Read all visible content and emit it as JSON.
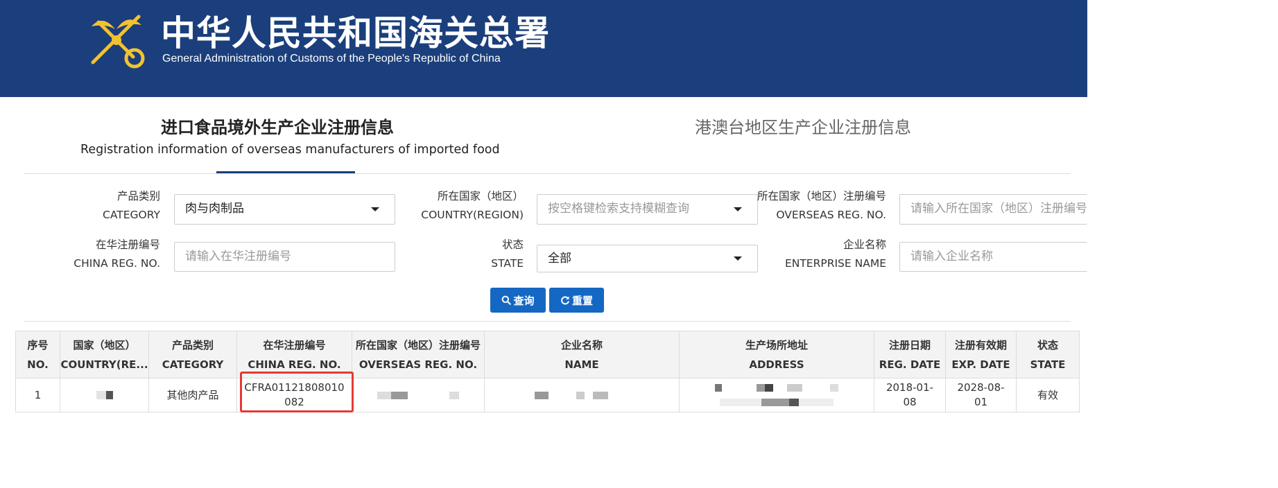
{
  "header": {
    "title_cn": "中华人民共和国海关总署",
    "title_en": "General Administration of Customs of the People's Republic of China"
  },
  "tabs": {
    "active_cn": "进口食品境外生产企业注册信息",
    "active_en": "Registration information of overseas manufacturers of imported food",
    "inactive_cn": "港澳台地区生产企业注册信息"
  },
  "filters": {
    "category": {
      "label_cn": "产品类别",
      "label_en": "CATEGORY",
      "value": "肉与肉制品"
    },
    "country": {
      "label_cn": "所在国家（地区）",
      "label_en": "COUNTRY(REGION)",
      "placeholder": "按空格键检索支持模糊查询"
    },
    "overseas_reg": {
      "label_cn": "所在国家（地区）注册编号",
      "label_en": "OVERSEAS REG. NO.",
      "placeholder": "请输入所在国家（地区）注册编号"
    },
    "china_reg": {
      "label_cn": "在华注册编号",
      "label_en": "CHINA REG. NO.",
      "placeholder": "请输入在华注册编号"
    },
    "state": {
      "label_cn": "状态",
      "label_en": "STATE",
      "value": "全部"
    },
    "enterprise": {
      "label_cn": "企业名称",
      "label_en": "ENTERPRISE NAME",
      "placeholder": "请输入企业名称"
    }
  },
  "buttons": {
    "search": "查询",
    "reset": "重置"
  },
  "table": {
    "columns": [
      {
        "cn": "序号",
        "en": "NO."
      },
      {
        "cn": "国家（地区）",
        "en": "COUNTRY(RE..."
      },
      {
        "cn": "产品类别",
        "en": "CATEGORY"
      },
      {
        "cn": "在华注册编号",
        "en": "CHINA REG. NO."
      },
      {
        "cn": "所在国家（地区）注册编号",
        "en": "OVERSEAS REG. NO."
      },
      {
        "cn": "企业名称",
        "en": "NAME"
      },
      {
        "cn": "生产场所地址",
        "en": "ADDRESS"
      },
      {
        "cn": "注册日期",
        "en": "REG. DATE"
      },
      {
        "cn": "注册有效期",
        "en": "EXP. DATE"
      },
      {
        "cn": "状态",
        "en": "STATE"
      }
    ],
    "rows": [
      {
        "no": "1",
        "category": "其他肉产品",
        "china_reg_line1": "CFRA01121808010",
        "china_reg_line2": "082",
        "reg_date_line1": "2018-01-",
        "reg_date_line2": "08",
        "exp_date_line1": "2028-08-",
        "exp_date_line2": "01",
        "state": "有效"
      }
    ]
  },
  "colors": {
    "banner": "#1b3f7c",
    "button": "#1567c4",
    "highlight": "#e53935"
  }
}
